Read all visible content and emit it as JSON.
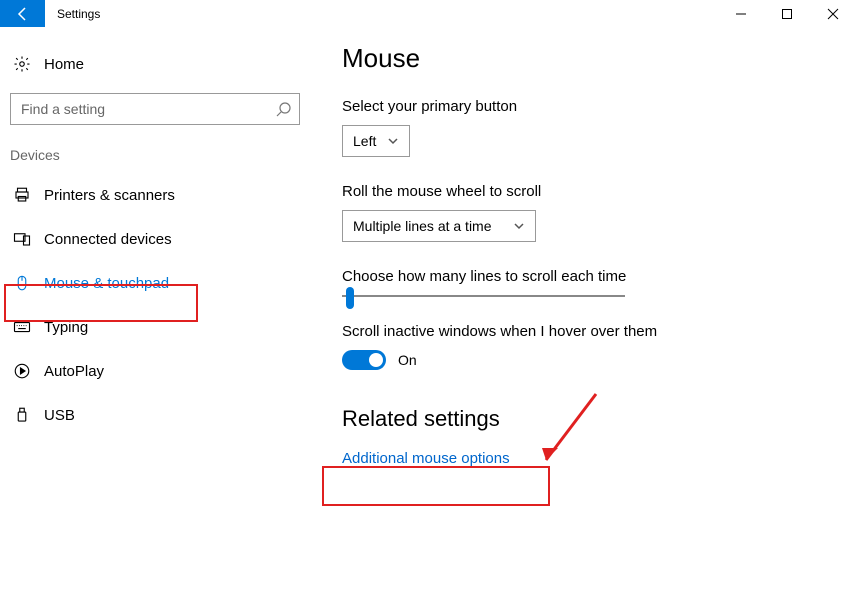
{
  "window": {
    "title": "Settings"
  },
  "sidebar": {
    "home_label": "Home",
    "search_placeholder": "Find a setting",
    "section_label": "Devices",
    "items": [
      {
        "label": "Printers & scanners"
      },
      {
        "label": "Connected devices"
      },
      {
        "label": "Mouse & touchpad"
      },
      {
        "label": "Typing"
      },
      {
        "label": "AutoPlay"
      },
      {
        "label": "USB"
      }
    ]
  },
  "main": {
    "title": "Mouse",
    "primary_button_label": "Select your primary button",
    "primary_button_value": "Left",
    "wheel_label": "Roll the mouse wheel to scroll",
    "wheel_value": "Multiple lines at a time",
    "lines_label": "Choose how many lines to scroll each time",
    "inactive_label": "Scroll inactive windows when I hover over them",
    "inactive_value": "On",
    "related_heading": "Related settings",
    "related_link": "Additional mouse options"
  }
}
